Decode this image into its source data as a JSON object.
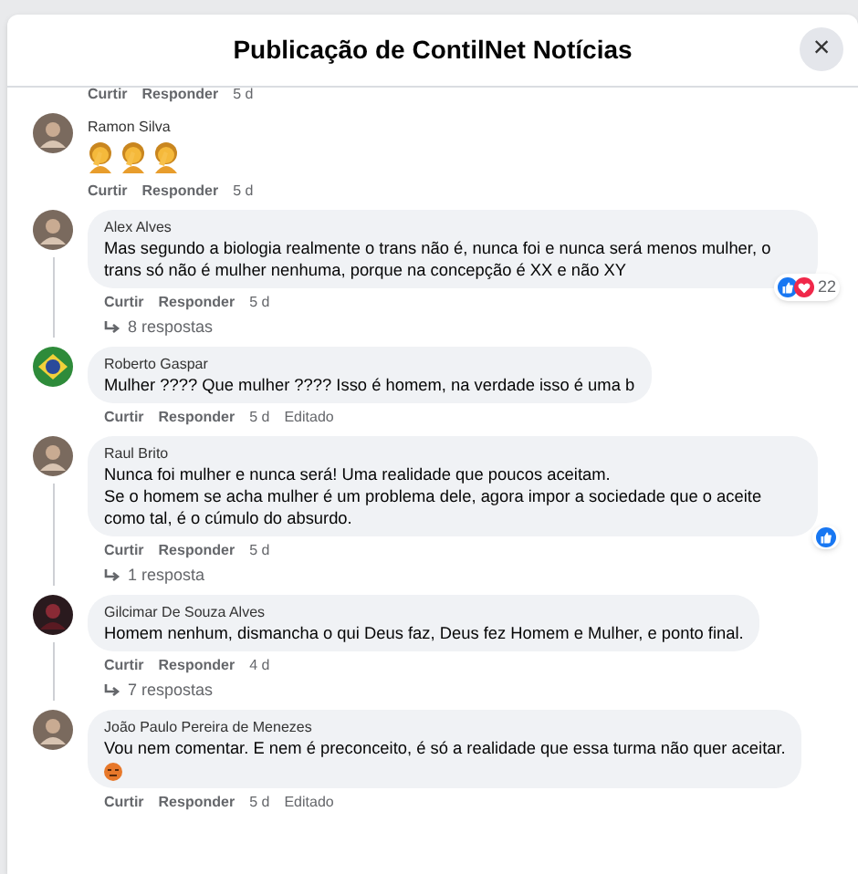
{
  "dialog": {
    "title": "Publicação de ContilNet Notícias",
    "close": "×"
  },
  "top_actions": {
    "like": "Curtir",
    "reply": "Responder",
    "time": "5 d"
  },
  "comments": [
    {
      "author": "Ramon Silva",
      "avatar": {
        "kind": "person"
      },
      "emojis": [
        {
          "kind": "facepalm"
        },
        {
          "kind": "facepalm"
        },
        {
          "kind": "facepalm"
        }
      ],
      "like": "Curtir",
      "reply": "Responder",
      "time": "5 d"
    },
    {
      "author": "Alex Alves",
      "avatar": {
        "kind": "person"
      },
      "text": "Mas segundo a biologia realmente o trans não é, nunca foi e nunca será menos mulher, o trans só não é mulher nenhuma, porque na concepção é XX e não XY",
      "reactions": {
        "icons": [
          {
            "kind": "like"
          },
          {
            "kind": "love"
          }
        ],
        "count": "22"
      },
      "like": "Curtir",
      "reply": "Responder",
      "time": "5 d",
      "replies": "8 respostas"
    },
    {
      "author": "Roberto Gaspar",
      "avatar": {
        "kind": "flag"
      },
      "text": "Mulher ???? Que mulher ???? Isso é homem, na verdade isso é uma b",
      "like": "Curtir",
      "reply": "Responder",
      "time": "5 d",
      "edited": "Editado"
    },
    {
      "author": "Raul Brito",
      "avatar": {
        "kind": "person"
      },
      "text": "Nunca foi mulher e nunca será! Uma realidade que poucos aceitam.\nSe o homem se acha mulher é um problema dele, agora impor a sociedade que o aceite como tal, é o cúmulo do absurdo.",
      "reactions": {
        "icons": [
          {
            "kind": "like"
          }
        ]
      },
      "like": "Curtir",
      "reply": "Responder",
      "time": "5 d",
      "replies": "1 resposta"
    },
    {
      "author": "Gilcimar De Souza Alves",
      "avatar": {
        "kind": "dark"
      },
      "text": "Homem nenhum, dismancha o qui Deus faz, Deus fez Homem e Mulher, e ponto final.",
      "like": "Curtir",
      "reply": "Responder",
      "time": "4 d",
      "replies": "7 respostas"
    },
    {
      "author": "João Paulo Pereira de Menezes",
      "avatar": {
        "kind": "person"
      },
      "text": "Vou nem comentar. E nem é preconceito, é só a realidade que essa turma não quer aceitar.",
      "emojis": [
        {
          "kind": "angry"
        }
      ],
      "like": "Curtir",
      "reply": "Responder",
      "time": "5 d",
      "edited": "Editado"
    }
  ]
}
